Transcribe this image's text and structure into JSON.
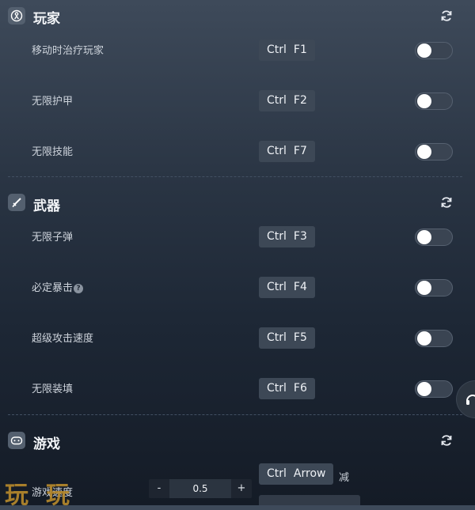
{
  "sections": {
    "player": {
      "title": "玩家",
      "rows": [
        {
          "label": "移动时治疗玩家",
          "mod": "Ctrl",
          "key": "F1",
          "enabled": false
        },
        {
          "label": "无限护甲",
          "mod": "Ctrl",
          "key": "F2",
          "enabled": false
        },
        {
          "label": "无限技能",
          "mod": "Ctrl",
          "key": "F7",
          "enabled": false
        }
      ]
    },
    "weapons": {
      "title": "武器",
      "rows": [
        {
          "label": "无限子弹",
          "mod": "Ctrl",
          "key": "F3",
          "enabled": false
        },
        {
          "label": "必定暴击",
          "mod": "Ctrl",
          "key": "F4",
          "enabled": false,
          "help": "?"
        },
        {
          "label": "超级攻击速度",
          "mod": "Ctrl",
          "key": "F5",
          "enabled": false
        },
        {
          "label": "无限装填",
          "mod": "Ctrl",
          "key": "F6",
          "enabled": false
        }
      ]
    },
    "game": {
      "title": "游戏",
      "speed": {
        "label": "游戏速度",
        "value": "0.5",
        "minus": "-",
        "plus": "+",
        "mod": "Ctrl",
        "key": "Arrow",
        "decrease_label": "减"
      }
    }
  },
  "watermark": "玩玩",
  "icons": {
    "player": "person-in-circle-icon",
    "weapons": "sword-icon",
    "game": "gamepad-icon",
    "reset": "refresh-icon",
    "float": "headset-icon"
  },
  "colors": {
    "hotkey_bg": "#3d4856",
    "toggle_off": "#3a4452",
    "watermark": "#b88a2c"
  }
}
